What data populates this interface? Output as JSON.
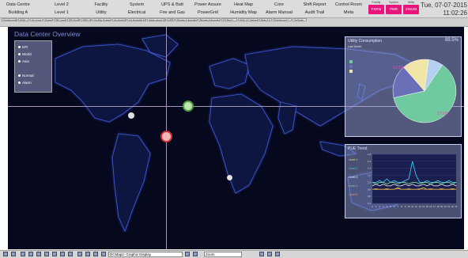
{
  "topnav": {
    "row1": [
      "Data Centre",
      "Level 2",
      "Facility",
      "System",
      "UPS & Batt",
      "Power Assure",
      "Heat Map",
      "Core",
      "Shift Report",
      "Control Room",
      "Maps"
    ],
    "row2": [
      "Building A",
      "Level 1",
      "Utility",
      "Electrical",
      "Fire and Gas",
      "PowerGrid",
      "Humidity Map",
      "Alarm Manual",
      "Audit Trail",
      "Meta"
    ],
    "pink_buttons": [
      {
        "top": "Facility",
        "label": "FSRM"
      },
      {
        "top": "System",
        "label": "PMR"
      },
      {
        "top": "Utility",
        "label": "ZINUM"
      }
    ],
    "date": "Tue, 07-07-2015",
    "time": "11:02:26"
  },
  "tabs": [
    "Dashboards",
    "ANAL-UC",
    "Air Lines",
    "Sample",
    "DR-Level",
    "DR-Facility",
    "UPS Util",
    "Air Fire System",
    "Air Heat Maps",
    "Air Humidity Map",
    "Alerts about ANNA",
    "AEP",
    "Private Automation",
    "Private Automation",
    "DCMap2",
    "ANA-UC Network",
    "Beta 3.0",
    "Dashboard 2",
    "ZeGrate"
  ],
  "map": {
    "title": "Data Center Overview",
    "legend_group1": [
      "KPI",
      "World",
      "Asia"
    ],
    "legend_group2": [
      "Normal",
      "Alarm"
    ],
    "accent": "#a596b8",
    "background": "#06081e"
  },
  "pie_panel": {
    "title": "Utility Consumption",
    "value": "89.5%",
    "subtitle": "Last Month",
    "legend": [
      "",
      "",
      ""
    ],
    "labels": [
      "13.5%",
      "",
      "17.0%",
      ""
    ],
    "chart_data": {
      "type": "pie",
      "values": [
        62,
        17,
        13.5,
        7.5
      ],
      "colors": [
        "#6fcaa0",
        "#6a70b8",
        "#efe6a8",
        "#b6d0f0"
      ]
    }
  },
  "trend_panel": {
    "title": "PUE Trend",
    "series_labels": [
      "Level 1",
      "Level 2",
      "Level 3",
      "Level 4",
      "Level 5"
    ],
    "y_ticks": [
      "1.8",
      "1.6",
      "1.4",
      "1.2",
      "1.0",
      "0.8",
      "0.6",
      "0.4"
    ],
    "x_ticks": [
      "0",
      "1",
      "2",
      "3",
      "4",
      "5",
      "6",
      "7",
      "8",
      "9",
      "10",
      "11",
      "12",
      "13",
      "14",
      "15",
      "16",
      "17",
      "18",
      "19",
      "20",
      "21",
      "22",
      "23"
    ],
    "chart_data": {
      "type": "line",
      "x": [
        0,
        1,
        2,
        3,
        4,
        5,
        6,
        7,
        8,
        9,
        10,
        11,
        12,
        13,
        14,
        15,
        16,
        17,
        18,
        19,
        20,
        21,
        22,
        23
      ],
      "series": [
        {
          "color": "#f0e060",
          "values": [
            0.8,
            0.8,
            0.8,
            0.8,
            0.8,
            0.8,
            0.8,
            0.85,
            0.8,
            0.8,
            0.8,
            0.8,
            0.8,
            0.8,
            0.85,
            0.8,
            0.8,
            0.8,
            0.8,
            0.8,
            0.8,
            0.8,
            0.8,
            0.8
          ]
        },
        {
          "color": "#3ad8ff",
          "values": [
            1.0,
            1.0,
            1.05,
            1.0,
            1.1,
            1.0,
            1.05,
            1.0,
            1.0,
            1.05,
            1.1,
            1.6,
            1.2,
            1.0,
            1.0,
            1.05,
            1.0,
            1.0,
            1.05,
            1.0,
            1.0,
            1.05,
            1.0,
            1.0
          ]
        },
        {
          "color": "#f7f7f7",
          "values": [
            0.9,
            0.95,
            0.9,
            0.95,
            0.9,
            0.9,
            0.95,
            0.9,
            0.9,
            0.95,
            0.9,
            0.95,
            0.9,
            0.9,
            0.95,
            0.9,
            0.95,
            0.9,
            0.9,
            0.95,
            0.9,
            0.9,
            0.95,
            0.9
          ]
        },
        {
          "color": "#7fe08a",
          "values": [
            1.0,
            0.95,
            1.0,
            1.0,
            0.95,
            1.0,
            1.0,
            0.95,
            1.0,
            1.0,
            0.95,
            1.0,
            1.0,
            0.95,
            1.0,
            1.0,
            0.95,
            1.0,
            1.0,
            0.95,
            1.0,
            1.0,
            0.95,
            1.0
          ]
        },
        {
          "color": "#e8a040",
          "values": [
            0.8,
            0.82,
            0.8,
            0.8,
            0.82,
            0.8,
            0.8,
            0.82,
            0.8,
            0.8,
            0.82,
            0.8,
            0.8,
            0.82,
            0.8,
            0.8,
            0.82,
            0.8,
            0.8,
            0.82,
            0.8,
            0.8,
            0.82,
            0.8
          ]
        }
      ],
      "ylim": [
        0.4,
        1.8
      ]
    }
  },
  "taskbar": {
    "field": "DCMap2: Graphic Display",
    "zoom": "Zoom"
  }
}
